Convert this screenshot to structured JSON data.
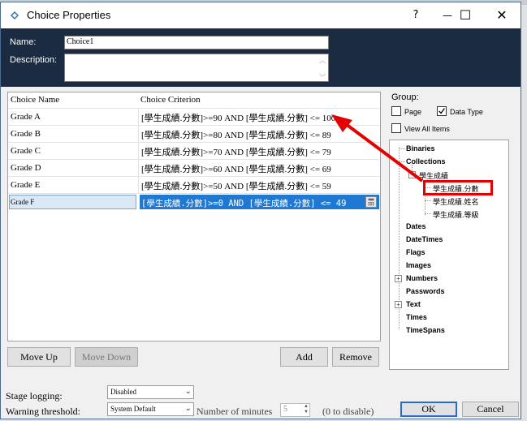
{
  "titlebar": {
    "title": "Choice Properties",
    "help_label": "?",
    "minimize_label": "—",
    "maximize_label": "☐",
    "close_label": "✕"
  },
  "form": {
    "name_label": "Name:",
    "name_value": "Choice1",
    "description_label": "Description:",
    "description_value": ""
  },
  "grid": {
    "col_name": "Choice Name",
    "col_criterion": "Choice Criterion",
    "rows": [
      {
        "name": "Grade A",
        "criterion": "[學生成績.分數]>=90 AND [學生成績.分數] <= 100"
      },
      {
        "name": "Grade B",
        "criterion": "[學生成績.分數]>=80 AND [學生成績.分數] <= 89"
      },
      {
        "name": "Grade C",
        "criterion": "[學生成績.分數]>=70 AND [學生成績.分數] <= 79"
      },
      {
        "name": "Grade D",
        "criterion": "[學生成績.分數]>=60 AND [學生成績.分數] <= 69"
      },
      {
        "name": "Grade E",
        "criterion": "[學生成績.分數]>=50 AND [學生成績.分數] <= 59"
      },
      {
        "name": "Grade F",
        "criterion": "[學生成績.分數]>=0 AND [學生成績.分數] <= 49"
      }
    ]
  },
  "group": {
    "label": "Group:",
    "page_label": "Page",
    "page_checked": false,
    "datatype_label": "Data Type",
    "datatype_checked": true,
    "viewall_label": "View All Items",
    "viewall_checked": false
  },
  "tree": {
    "binaries": "Binaries",
    "collections": "Collections",
    "collection_name": "學生成績",
    "field_score": "學生成績.分數",
    "field_name": "學生成績.姓名",
    "field_grade": "學生成績.等級",
    "dates": "Dates",
    "datetimes": "DateTimes",
    "flags": "Flags",
    "images": "Images",
    "numbers": "Numbers",
    "passwords": "Passwords",
    "text": "Text",
    "times": "Times",
    "timespans": "TimeSpans"
  },
  "buttons": {
    "move_up": "Move Up",
    "move_down": "Move Down",
    "add": "Add",
    "remove": "Remove",
    "ok": "OK",
    "cancel": "Cancel"
  },
  "bottom": {
    "stage_logging_label": "Stage logging:",
    "stage_logging_value": "Disabled",
    "warning_label": "Warning threshold:",
    "warning_value": "System Default",
    "minutes_label": "Number of minutes",
    "minutes_value": "5",
    "disable_hint": "(0 to disable)"
  },
  "colors": {
    "header_band": "#1a2b42",
    "selection": "#1f78d1",
    "annotation_red": "#e40000"
  }
}
